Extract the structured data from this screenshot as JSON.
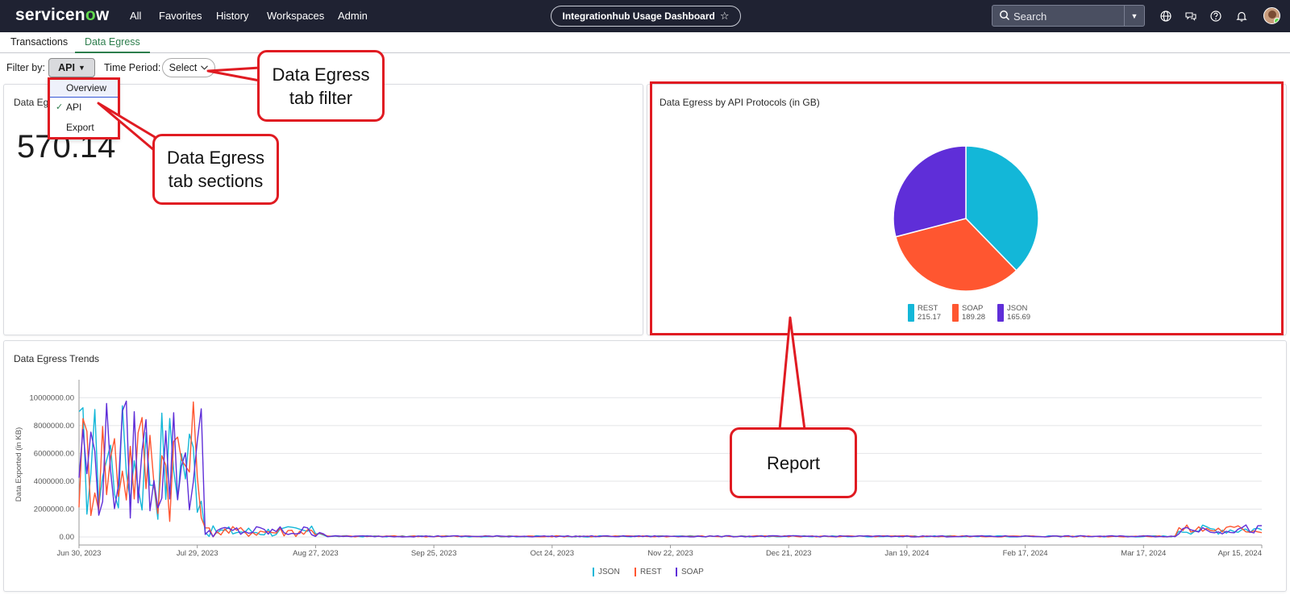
{
  "header": {
    "logo_text_a": "servicen",
    "logo_text_o": "o",
    "logo_text_b": "w",
    "nav": [
      "All",
      "Favorites",
      "History",
      "Workspaces",
      "Admin"
    ],
    "dashboard_title": "Integrationhub Usage Dashboard",
    "search_placeholder": "Search"
  },
  "tabs": [
    {
      "label": "Transactions",
      "active": false
    },
    {
      "label": "Data Egress",
      "active": true
    }
  ],
  "filters": {
    "filter_label": "Filter by:",
    "filter_value": "API",
    "time_label": "Time Period:",
    "time_value": "Select",
    "menu_items": [
      {
        "label": "Overview",
        "checked": false
      },
      {
        "label": "API",
        "checked": true
      },
      {
        "label": "Export",
        "checked": false
      }
    ]
  },
  "total_card": {
    "title": "Data Eg",
    "value": "570.14"
  },
  "pie_card": {
    "title": "Data Egress by API Protocols (in GB)"
  },
  "trend_card": {
    "title": "Data Egress Trends"
  },
  "annotations": {
    "filter_callout_line1": "Data Egress",
    "filter_callout_line2": "tab filter",
    "sections_callout_line1": "Data Egress",
    "sections_callout_line2": "tab sections",
    "report_callout": "Report"
  },
  "colors": {
    "rest": "#13b7d8",
    "soap": "#ff5630",
    "json": "#5f2ed8",
    "accent": "#2d7e4d",
    "annotation": "#e01b22"
  },
  "chart_data": [
    {
      "type": "pie",
      "title": "Data Egress by API Protocols (in GB)",
      "categories": [
        "REST",
        "SOAP",
        "JSON"
      ],
      "values": [
        215.17,
        189.28,
        165.69
      ],
      "value_labels": [
        "215.17",
        "189.28",
        "165.69"
      ],
      "legend": "bottom"
    },
    {
      "type": "line",
      "title": "Data Egress Trends",
      "xlabel": "",
      "ylabel": "Data Exported (in KB)",
      "ylim": [
        0,
        11000000
      ],
      "yticks": [
        "0.00",
        "2000000.00",
        "4000000.00",
        "6000000.00",
        "8000000.00",
        "10000000.00"
      ],
      "xticks": [
        "Jun 30, 2023",
        "Jul 29, 2023",
        "Aug 27, 2023",
        "Sep 25, 2023",
        "Oct 24, 2023",
        "Nov 22, 2023",
        "Dec 21, 2023",
        "Jan 19, 2024",
        "Feb 17, 2024",
        "Mar 17, 2024",
        "Apr 15, 2024"
      ],
      "grid": true,
      "legend": "bottom",
      "series": [
        {
          "name": "JSON"
        },
        {
          "name": "REST"
        },
        {
          "name": "SOAP"
        }
      ]
    }
  ]
}
